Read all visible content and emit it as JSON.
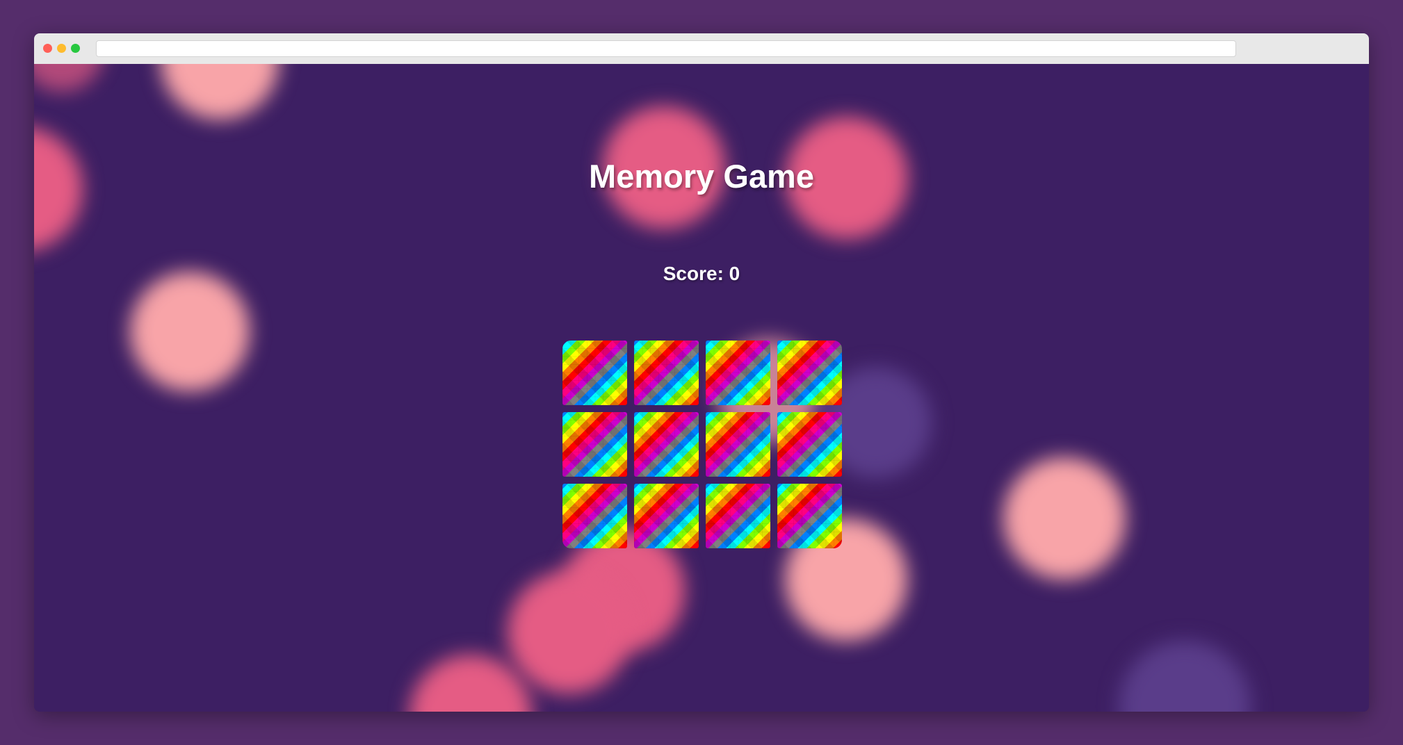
{
  "browser": {
    "url": ""
  },
  "game": {
    "title": "Memory Game",
    "score_text": "Score: 0",
    "score": 0,
    "cards": [
      {
        "state": "face-down"
      },
      {
        "state": "face-down"
      },
      {
        "state": "face-down"
      },
      {
        "state": "face-down"
      },
      {
        "state": "face-down"
      },
      {
        "state": "face-down"
      },
      {
        "state": "face-down"
      },
      {
        "state": "face-down"
      },
      {
        "state": "face-down"
      },
      {
        "state": "face-down"
      },
      {
        "state": "face-down"
      },
      {
        "state": "face-down"
      }
    ]
  },
  "colors": {
    "page_background": "#552d6b",
    "viewport_background": "#3d1f63",
    "bokeh_pink": "#e55c84",
    "bokeh_peach": "#f8a4a8",
    "bokeh_violet": "#5a3d8a"
  }
}
